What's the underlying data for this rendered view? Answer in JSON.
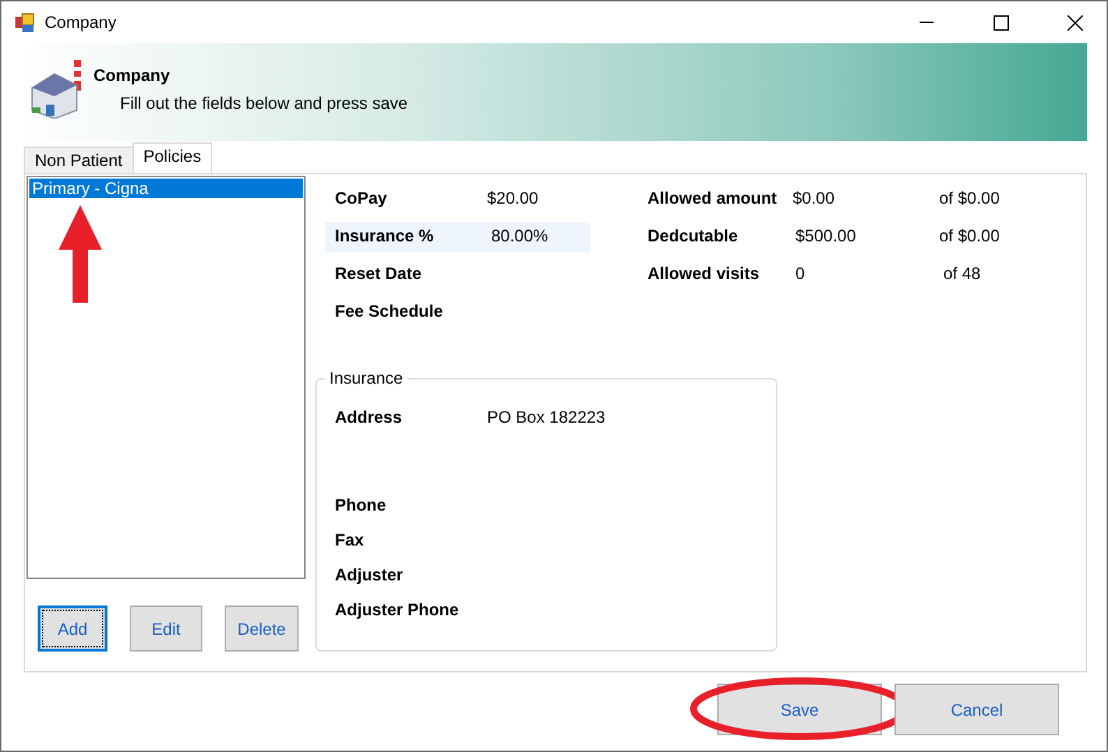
{
  "window": {
    "title": "Company"
  },
  "header": {
    "title": "Company",
    "subtitle": "Fill out the fields below and press save"
  },
  "tabs": [
    {
      "label": "Non Patient",
      "selected": false
    },
    {
      "label": "Policies",
      "selected": true
    }
  ],
  "policies": [
    {
      "label": "Primary - Cigna",
      "selected": true
    }
  ],
  "list_buttons": [
    {
      "label": "Add",
      "focused": true
    },
    {
      "label": "Edit",
      "focused": false
    },
    {
      "label": "Delete",
      "focused": false
    }
  ],
  "policy_fields": [
    {
      "label": "CoPay",
      "value": "$20.00"
    },
    {
      "label": "Insurance %",
      "value": "80.00%"
    },
    {
      "label": "Reset Date"
    },
    {
      "label": "Fee Schedule"
    }
  ],
  "limits": [
    {
      "label": "Allowed amount",
      "value": "$0.00",
      "of": "of $0.00"
    },
    {
      "label": "Dedcutable",
      "value": "$500.00",
      "of": "of $0.00"
    },
    {
      "label": "Allowed visits",
      "value": "0",
      "of": "of 48"
    }
  ],
  "insurance": {
    "title": "Insurance",
    "fields": [
      {
        "label": "Address",
        "value": "PO Box 182223",
        "tall": true
      },
      {
        "label": "Phone",
        "tall": false
      },
      {
        "label": "Fax",
        "tall": false
      },
      {
        "label": "Adjuster",
        "tall": false
      },
      {
        "label": "Adjuster Phone",
        "tall": false
      }
    ]
  },
  "dialog_buttons": [
    {
      "label": "Save",
      "circled": true
    },
    {
      "label": "Cancel",
      "circled": false
    }
  ]
}
